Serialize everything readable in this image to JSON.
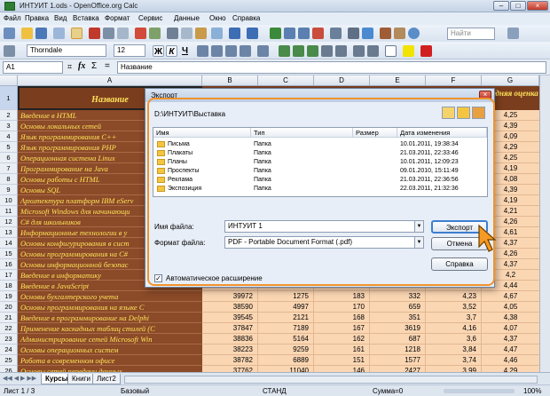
{
  "window": {
    "title": "ИНТУИТ 1.ods - OpenOffice.org Calc"
  },
  "menu": [
    "Файл",
    "Правка",
    "Вид",
    "Вставка",
    "Формат",
    "Сервис",
    "Данные",
    "Окно",
    "Справка"
  ],
  "toolbar": {
    "font_name": "Thorndale",
    "font_size": "12",
    "bold": "Ж",
    "italic": "К",
    "underline": "Ч",
    "find_placeholder": "Найти"
  },
  "formula": {
    "cell_ref": "A1",
    "content": "Название"
  },
  "sheet": {
    "columns": [
      "A",
      "B",
      "C",
      "D",
      "E",
      "F",
      "G"
    ],
    "header_name": "Название",
    "header_avg": "Средняя оценка",
    "rows": [
      {
        "n": "2",
        "name": "Введение в HTML",
        "g": "4,25"
      },
      {
        "n": "3",
        "name": "Основы локальных сетей",
        "g": "4,39"
      },
      {
        "n": "4",
        "name": "Язык программирования C++",
        "g": "4,09"
      },
      {
        "n": "5",
        "name": "Язык программирования PHP",
        "g": "4,29"
      },
      {
        "n": "6",
        "name": "Операционная система Linux",
        "g": "4,25"
      },
      {
        "n": "7",
        "name": "Программирование на Java",
        "g": "4,19"
      },
      {
        "n": "8",
        "name": "Основы работы с HTML",
        "g": "4,08"
      },
      {
        "n": "9",
        "name": "Основы SQL",
        "g": "4,39"
      },
      {
        "n": "10",
        "name": "Архитектура платформ IBM eServ",
        "g": "4,19"
      },
      {
        "n": "11",
        "name": "Microsoft Windows для начинающи",
        "g": "4,21"
      },
      {
        "n": "12",
        "name": "C# для школьников",
        "g": "4,26"
      },
      {
        "n": "13",
        "name": "Информационные технологии в у",
        "g": "4,61"
      },
      {
        "n": "14",
        "name": "Основы конфигурирования в сист",
        "g": "4,37"
      },
      {
        "n": "15",
        "name": "Основы программирования на C#",
        "g": "4,26"
      },
      {
        "n": "16",
        "name": "Основы информационной безопас",
        "g": "4,37"
      },
      {
        "n": "17",
        "name": "Введение в информатику",
        "g": "4,2"
      },
      {
        "n": "18",
        "name": "Введение в JavaScript",
        "g": "4,44"
      },
      {
        "n": "19",
        "name": "Основы бухгалтерского учета",
        "b": "39972",
        "c": "1275",
        "d": "183",
        "e": "332",
        "f": "4,23",
        "g": "4,67"
      },
      {
        "n": "20",
        "name": "Основы программирования на языке C",
        "b": "38590",
        "c": "4997",
        "d": "170",
        "e": "659",
        "f": "3,52",
        "g": "4,05"
      },
      {
        "n": "21",
        "name": "Введение в программирование на Delphi",
        "b": "39545",
        "c": "2121",
        "d": "168",
        "e": "351",
        "f": "3,7",
        "g": "4,38"
      },
      {
        "n": "22",
        "name": "Применение каскадных таблиц стилей (C",
        "b": "37847",
        "c": "7189",
        "d": "167",
        "e": "3619",
        "f": "4,16",
        "g": "4,07"
      },
      {
        "n": "23",
        "name": "Администрирование сетей Microsoft Win",
        "b": "38836",
        "c": "5164",
        "d": "162",
        "e": "687",
        "f": "3,6",
        "g": "4,37"
      },
      {
        "n": "24",
        "name": "Основы операционных систем",
        "b": "38223",
        "c": "9259",
        "d": "161",
        "e": "1218",
        "f": "3,84",
        "g": "4,47"
      },
      {
        "n": "25",
        "name": "Работа в современном офисе",
        "b": "38782",
        "c": "6889",
        "d": "151",
        "e": "1577",
        "f": "3,74",
        "g": "4,46"
      },
      {
        "n": "26",
        "name": "Основы сетей передачи данных",
        "b": "37762",
        "c": "11040",
        "d": "146",
        "e": "2427",
        "f": "3,99",
        "g": "4,29"
      }
    ]
  },
  "sheet_tabs": [
    "Курсы",
    "Книги",
    "Лист2"
  ],
  "status": {
    "sheet": "Лист 1 / 3",
    "style": "Базовый",
    "mode": "СТАНД",
    "sum": "Сумма=0",
    "zoom": "100%"
  },
  "dialog": {
    "title": "Экспорт",
    "path": "D:\\ИНТУИТ\\Выставка",
    "columns": [
      "Имя",
      "Тип",
      "Размер",
      "Дата изменения"
    ],
    "files": [
      {
        "name": "Письма",
        "type": "Папка",
        "date": "10.01.2011, 19:38:34"
      },
      {
        "name": "Плакаты",
        "type": "Папка",
        "date": "21.03.2011, 22:33:46"
      },
      {
        "name": "Планы",
        "type": "Папка",
        "date": "10.01.2011, 12:09:23"
      },
      {
        "name": "Проспекты",
        "type": "Папка",
        "date": "09.01.2010, 15:11:49"
      },
      {
        "name": "Реклама",
        "type": "Папка",
        "date": "21.03.2011, 22:36:56"
      },
      {
        "name": "Экспозиция",
        "type": "Папка",
        "date": "22.03.2011, 21:32:36"
      }
    ],
    "file_name_label": "Имя файла:",
    "file_name_value": "ИНТУИТ 1",
    "file_type_label": "Формат файла:",
    "file_type_value": "PDF - Portable Document Format (.pdf)",
    "export_button": "Экспорт",
    "cancel_button": "Отмена",
    "help_button": "Справка",
    "autoext_label": "Автоматическое расширение",
    "autoext_checked": true
  }
}
